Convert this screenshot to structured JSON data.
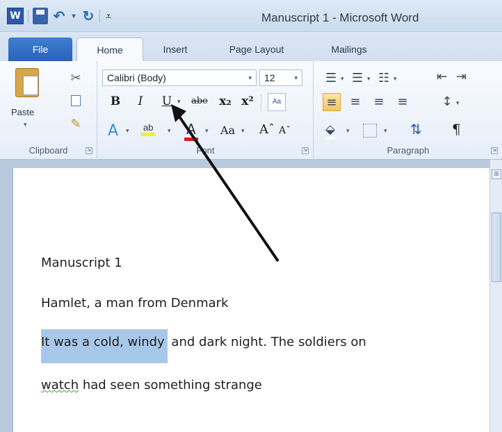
{
  "titlebar": {
    "title": "Manuscript 1  -  Microsoft Word",
    "app_icon_letter": "W",
    "icons": [
      "word-app-icon",
      "save-icon",
      "undo-icon",
      "redo-icon",
      "customize-qat-icon"
    ]
  },
  "tabs": [
    {
      "label": "File"
    },
    {
      "label": "Home"
    },
    {
      "label": "Insert"
    },
    {
      "label": "Page Layout"
    },
    {
      "label": "Mailings"
    }
  ],
  "ribbon": {
    "clipboard": {
      "group_label": "Clipboard",
      "paste_label": "Paste"
    },
    "font": {
      "group_label": "Font",
      "font_name": "Calibri (Body)",
      "font_size": "12",
      "bold": "B",
      "italic": "I",
      "underline": "U",
      "strikethrough": "abe",
      "subscript": "x₂",
      "superscript": "x²",
      "change_case": "Aa",
      "grow": "Aˆ",
      "shrink": "Aˇ",
      "highlight": "ab",
      "font_color": "A",
      "highlight_color": "#f5ef24",
      "font_color_value": "#e01b1b"
    },
    "paragraph": {
      "group_label": "Paragraph",
      "show_marks": "¶"
    }
  },
  "document": {
    "lines": [
      {
        "text": "Manuscript 1"
      },
      {
        "text": "Hamlet, a man from Denmark"
      },
      {
        "selected": "It was a cold, windy",
        "rest": " and dark night. The soldiers on"
      },
      {
        "squiggle": "watch",
        "rest": " had seen something strange"
      }
    ],
    "selection_color": "#a8c8ea"
  }
}
